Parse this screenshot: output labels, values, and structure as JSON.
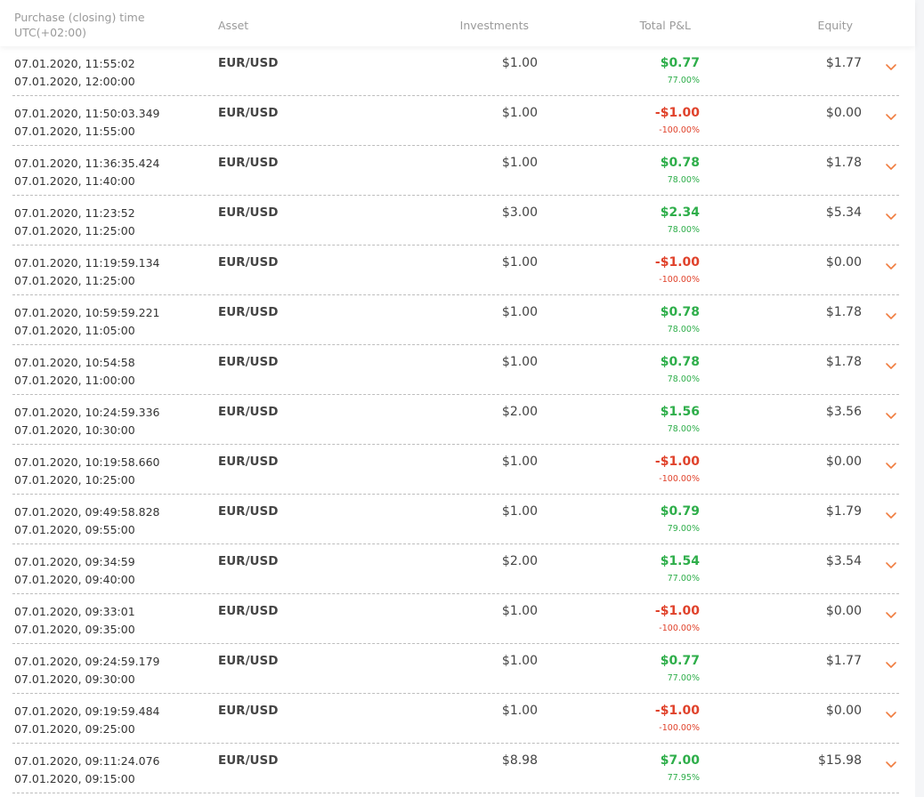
{
  "header": {
    "time_line1": "Purchase (closing) time",
    "time_line2": "UTC(+02:00)",
    "asset": "Asset",
    "investments": "Investments",
    "total_pnl": "Total P&L",
    "equity": "Equity"
  },
  "colors": {
    "positive": "#2eae4a",
    "negative": "#e0422b",
    "chevron": "#f07c3f",
    "header_text": "#9a9a9a"
  },
  "icons": {
    "expand": "chevron-down-icon"
  },
  "rows": [
    {
      "open": "07.01.2020, 11:55:02",
      "close": "07.01.2020, 12:00:00",
      "asset": "EUR/USD",
      "investment": "$1.00",
      "pnl": "$0.77",
      "pct": "77.00%",
      "equity": "$1.77",
      "status": "positive"
    },
    {
      "open": "07.01.2020, 11:50:03.349",
      "close": "07.01.2020, 11:55:00",
      "asset": "EUR/USD",
      "investment": "$1.00",
      "pnl": "-$1.00",
      "pct": "-100.00%",
      "equity": "$0.00",
      "status": "negative"
    },
    {
      "open": "07.01.2020, 11:36:35.424",
      "close": "07.01.2020, 11:40:00",
      "asset": "EUR/USD",
      "investment": "$1.00",
      "pnl": "$0.78",
      "pct": "78.00%",
      "equity": "$1.78",
      "status": "positive"
    },
    {
      "open": "07.01.2020, 11:23:52",
      "close": "07.01.2020, 11:25:00",
      "asset": "EUR/USD",
      "investment": "$3.00",
      "pnl": "$2.34",
      "pct": "78.00%",
      "equity": "$5.34",
      "status": "positive"
    },
    {
      "open": "07.01.2020, 11:19:59.134",
      "close": "07.01.2020, 11:25:00",
      "asset": "EUR/USD",
      "investment": "$1.00",
      "pnl": "-$1.00",
      "pct": "-100.00%",
      "equity": "$0.00",
      "status": "negative"
    },
    {
      "open": "07.01.2020, 10:59:59.221",
      "close": "07.01.2020, 11:05:00",
      "asset": "EUR/USD",
      "investment": "$1.00",
      "pnl": "$0.78",
      "pct": "78.00%",
      "equity": "$1.78",
      "status": "positive"
    },
    {
      "open": "07.01.2020, 10:54:58",
      "close": "07.01.2020, 11:00:00",
      "asset": "EUR/USD",
      "investment": "$1.00",
      "pnl": "$0.78",
      "pct": "78.00%",
      "equity": "$1.78",
      "status": "positive"
    },
    {
      "open": "07.01.2020, 10:24:59.336",
      "close": "07.01.2020, 10:30:00",
      "asset": "EUR/USD",
      "investment": "$2.00",
      "pnl": "$1.56",
      "pct": "78.00%",
      "equity": "$3.56",
      "status": "positive"
    },
    {
      "open": "07.01.2020, 10:19:58.660",
      "close": "07.01.2020, 10:25:00",
      "asset": "EUR/USD",
      "investment": "$1.00",
      "pnl": "-$1.00",
      "pct": "-100.00%",
      "equity": "$0.00",
      "status": "negative"
    },
    {
      "open": "07.01.2020, 09:49:58.828",
      "close": "07.01.2020, 09:55:00",
      "asset": "EUR/USD",
      "investment": "$1.00",
      "pnl": "$0.79",
      "pct": "79.00%",
      "equity": "$1.79",
      "status": "positive"
    },
    {
      "open": "07.01.2020, 09:34:59",
      "close": "07.01.2020, 09:40:00",
      "asset": "EUR/USD",
      "investment": "$2.00",
      "pnl": "$1.54",
      "pct": "77.00%",
      "equity": "$3.54",
      "status": "positive"
    },
    {
      "open": "07.01.2020, 09:33:01",
      "close": "07.01.2020, 09:35:00",
      "asset": "EUR/USD",
      "investment": "$1.00",
      "pnl": "-$1.00",
      "pct": "-100.00%",
      "equity": "$0.00",
      "status": "negative"
    },
    {
      "open": "07.01.2020, 09:24:59.179",
      "close": "07.01.2020, 09:30:00",
      "asset": "EUR/USD",
      "investment": "$1.00",
      "pnl": "$0.77",
      "pct": "77.00%",
      "equity": "$1.77",
      "status": "positive"
    },
    {
      "open": "07.01.2020, 09:19:59.484",
      "close": "07.01.2020, 09:25:00",
      "asset": "EUR/USD",
      "investment": "$1.00",
      "pnl": "-$1.00",
      "pct": "-100.00%",
      "equity": "$0.00",
      "status": "negative"
    },
    {
      "open": "07.01.2020, 09:11:24.076",
      "close": "07.01.2020, 09:15:00",
      "asset": "EUR/USD",
      "investment": "$8.98",
      "pnl": "$7.00",
      "pct": "77.95%",
      "equity": "$15.98",
      "status": "positive"
    }
  ]
}
